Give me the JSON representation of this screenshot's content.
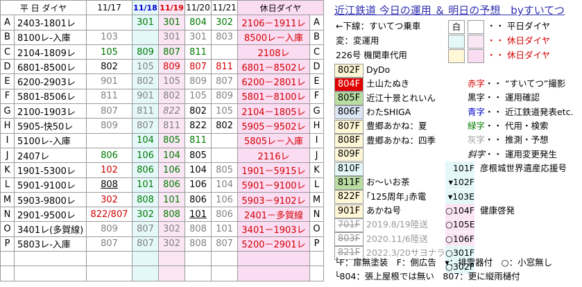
{
  "headers": {
    "schedule": "平 日 ダイヤ",
    "d1": "11/17",
    "d2": "11/18",
    "d3": "11/19",
    "d4": "11/20",
    "d5": "11/21",
    "holiday": "休日ダイヤ"
  },
  "rows": [
    {
      "id": "A",
      "sched": "2403-1801レ",
      "d1": "",
      "d2": "301",
      "d3": "301",
      "d4": "804",
      "d5": "302",
      "hol": "2106－1911レ"
    },
    {
      "id": "B",
      "sched": "8100レ-入庫",
      "d1": "103",
      "d2": "",
      "d3": "301",
      "d4": "301",
      "d5": "803",
      "hol": "8500レ－入庫"
    },
    {
      "id": "C",
      "sched": "2104-1809レ",
      "d1": "105",
      "d2": "809",
      "d3": "807",
      "d4": "811",
      "d5": "",
      "hol": "2108レ"
    },
    {
      "id": "D",
      "sched": "6801-8500レ",
      "d1": "802",
      "d2": "105",
      "d3": "809",
      "d4": "807",
      "d5": "811",
      "hol": "6801－8502レ"
    },
    {
      "id": "E",
      "sched": "6200-2903レ",
      "d1": "901",
      "d2": "802",
      "d3": "105",
      "d4": "809",
      "d5": "807",
      "hol": "6200－2801レ"
    },
    {
      "id": "F",
      "sched": "5801-8506レ",
      "d1": "811",
      "d2": "901",
      "d3": "802",
      "d4": "105",
      "d5": "809",
      "hol": "5801－8100レ"
    },
    {
      "id": "G",
      "sched": "2100-1903レ",
      "d1": "807",
      "d2": "811",
      "d3": "822",
      "d4": "802",
      "d5": "105",
      "hol": "2104－1805レ"
    },
    {
      "id": "H",
      "sched": "5905-快50レ",
      "d1": "809",
      "d2": "807",
      "d3": "811",
      "d4": "822",
      "d5": "802",
      "hol": "5905－9502レ"
    },
    {
      "id": "I",
      "sched": "5100レ-入庫",
      "d1": "",
      "d2": "104",
      "d3": "805",
      "d4": "811",
      "d5": "",
      "hol": "5805レ－入庫"
    },
    {
      "id": "J",
      "sched": "2407レ",
      "d1": "806",
      "d2": "106",
      "d3": "104",
      "d4": "805",
      "d5": "",
      "hol": "2116レ"
    },
    {
      "id": "K",
      "sched": "1901-5300レ",
      "d1": "102",
      "d2": "806",
      "d3": "106",
      "d4": "104",
      "d5": "805",
      "hol": "1901－5915レ"
    },
    {
      "id": "L",
      "sched": "5901-9100レ",
      "d1": "808",
      "d2": "101",
      "d3": "806",
      "d4": "106",
      "d5": "104",
      "hol": "5901－9100レ"
    },
    {
      "id": "M",
      "sched": "5903-9800レ",
      "d1": "302",
      "d2": "808",
      "d3": "101",
      "d4": "806",
      "d5": "106",
      "hol": "5903－9102レ"
    },
    {
      "id": "N",
      "sched": "2901-9500レ",
      "d1": "822/807",
      "d2": "302",
      "d3": "808",
      "d4": "101",
      "d5": "806",
      "hol": "2401－多賀線"
    },
    {
      "id": "O",
      "sched": "3401レ(多賀線)",
      "d1": "809",
      "d2": "807",
      "d3": "302",
      "d4": "808",
      "d5": "101",
      "hol": "3401－1903レ"
    },
    {
      "id": "P",
      "sched": "5803レ-入庫",
      "d1": "807",
      "d2": "807",
      "d3": "302",
      "d4": "808",
      "d5": "807",
      "hol": "5200－2901レ"
    }
  ],
  "legend": {
    "title": "近江鉄道 今日の運用 ＆ 明日の予想　byすいてつ",
    "l1": "←下線：すいてつ乗車",
    "l2": "変：変運用",
    "l3": "226号 機関車代用",
    "white": "白",
    "wd": "・・ 平日ダイヤ",
    "hol1": "・・ 休日ダイヤ",
    "hol2": "・・ 休日ダイヤ",
    "trains": [
      {
        "no": "802F",
        "name": "DyDo",
        "bg": "#fff7d6"
      },
      {
        "no": "804F",
        "name": "土山たぬき",
        "bg": "#e00000",
        "fg": "#fff"
      },
      {
        "no": "805F",
        "name": "近江十景とれいん",
        "bg": "#b9dca2"
      },
      {
        "no": "806F",
        "name": "わたSHIGA",
        "bg": "#dde6f5"
      },
      {
        "no": "807F",
        "name": "豊郷あかね：夏",
        "bg": "#fff7d6"
      },
      {
        "no": "808F",
        "name": "豊郷あかね：四季",
        "bg": "#fff7d6"
      },
      {
        "no": "809F",
        "name": "",
        "bg": "#fff7d6"
      },
      {
        "no": "810F",
        "name": "",
        "bg": "#e4f8fa"
      },
      {
        "no": "811F",
        "name": "お～いお茶",
        "bg": "#b9dca2"
      },
      {
        "no": "822F",
        "name": "｢125周年｣赤電",
        "bg": "#fff7d6"
      },
      {
        "no": "901F",
        "name": "あかね号",
        "bg": "#fff7d6"
      },
      {
        "no": "701F",
        "name": "2019.8/19陸送",
        "bg": "#fff"
      },
      {
        "no": "803F",
        "name": "2020.11/6陸送",
        "bg": "#fff"
      },
      {
        "no": "821F",
        "name": "2022.3/20サヨナラ",
        "bg": "#fff"
      }
    ],
    "notes": [
      {
        "a": "赤字",
        "b": "・・ “すいてつ”撮影",
        "c": "#d40000"
      },
      {
        "a": "黒字",
        "b": "・・ 運用確認",
        "c": "#000"
      },
      {
        "a": "青字",
        "b": "・・ 近江鉄道発表etc.",
        "c": "#0000cc"
      },
      {
        "a": "緑字",
        "b": "・・ 代用・検索",
        "c": "#007a00"
      },
      {
        "a": "灰字",
        "b": "・・ 推測・予想",
        "c": "#999"
      },
      {
        "a": "斜字",
        "b": "・・ 運用変更発生",
        "c": "#000"
      }
    ],
    "side": [
      {
        "no": "101F",
        "name": "彦根城世界遺産応援号"
      },
      {
        "no": "▾102F",
        "name": ""
      },
      {
        "no": "▾103E",
        "name": ""
      },
      {
        "no": "○104F",
        "name": "健康啓発"
      },
      {
        "no": "○105E",
        "name": ""
      },
      {
        "no": "○106F",
        "name": ""
      },
      {
        "no": "○301F",
        "name": ""
      },
      {
        "no": "○302F",
        "name": ""
      }
    ],
    "foot1": "└F：扉無塗装　F：側広告　▾：排雪器付　○：小窓無し",
    "foot2": "└804：張上屋根では無い　807：更に縦雨樋付"
  }
}
